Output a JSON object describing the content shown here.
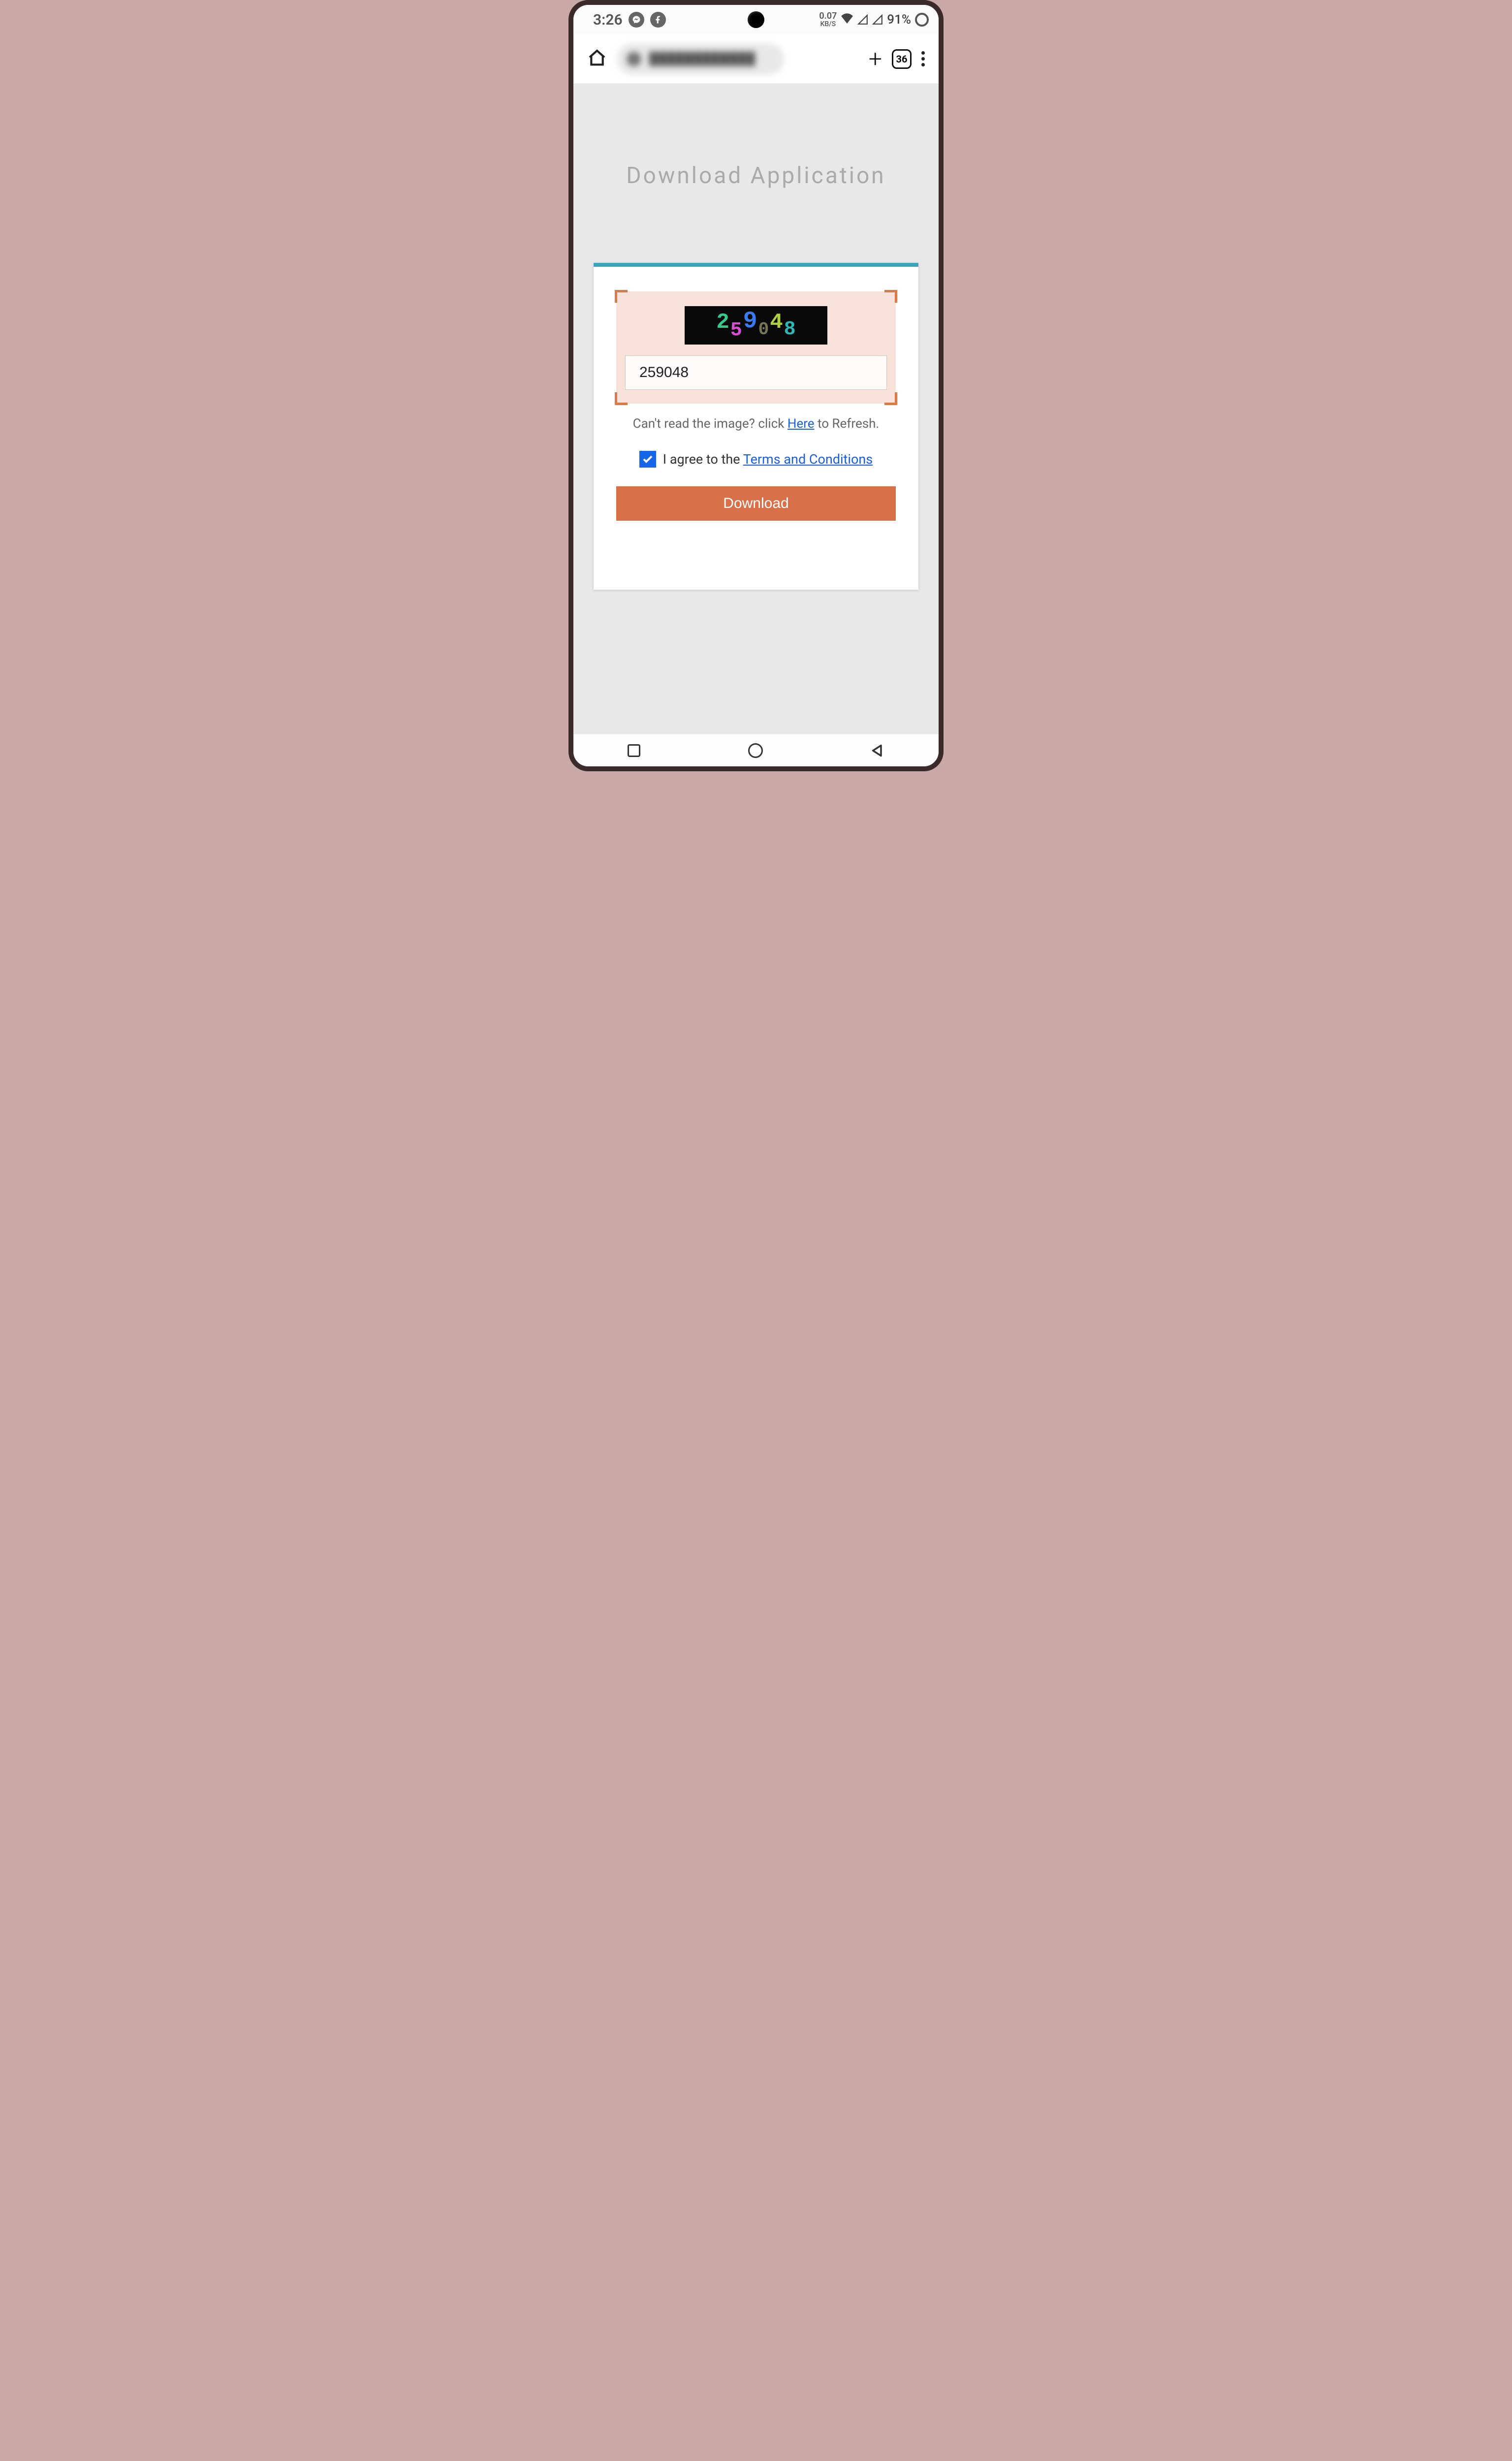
{
  "status": {
    "time": "3:26",
    "data_rate": "0.07",
    "data_unit": "KB/S",
    "battery": "91%"
  },
  "browser": {
    "tab_count": "36"
  },
  "page": {
    "title": "Download Application"
  },
  "captcha": {
    "digits": [
      "2",
      "5",
      "9",
      "0",
      "4",
      "8"
    ],
    "input_value": "259048",
    "refresh_pre": "Can't read the image? click ",
    "refresh_link": "Here",
    "refresh_post": " to Refresh."
  },
  "agree": {
    "checked": true,
    "label_pre": "I agree to the ",
    "link": "Terms and Conditions"
  },
  "download": {
    "label": "Download"
  }
}
